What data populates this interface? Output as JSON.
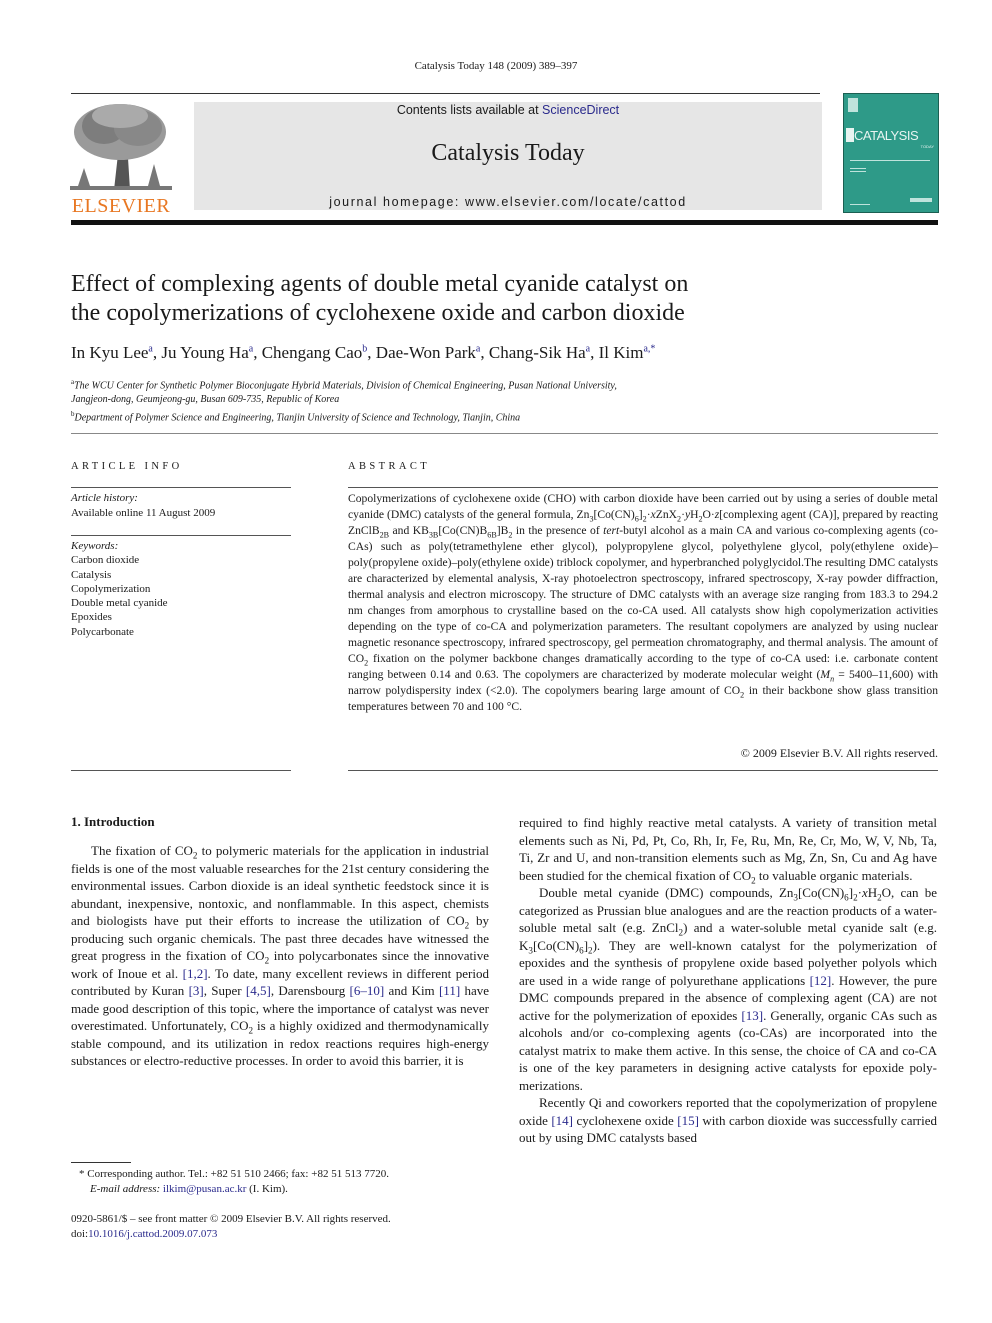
{
  "running_head": "Catalysis Today 148 (2009) 389–397",
  "masthead": {
    "publisher": "ELSEVIER",
    "publisher_color": "#e87722",
    "contents_prefix": "Contents lists available at ",
    "contents_link": "ScienceDirect",
    "journal_name": "Catalysis Today",
    "homepage": "journal homepage: www.elsevier.com/locate/cattod",
    "cover_title": "CATALYSIS",
    "cover_subtitle": "TODAY",
    "cover_color": "#2e9a88",
    "banner_color": "#e6e6e6"
  },
  "article": {
    "title_line1": "Effect of complexing agents of double metal cyanide catalyst on",
    "title_line2": "the copolymerizations of cyclohexene oxide and carbon dioxide",
    "authors": [
      {
        "name": "In Kyu Lee",
        "aff": "a"
      },
      {
        "name": "Ju Young Ha",
        "aff": "a"
      },
      {
        "name": "Chengang Cao",
        "aff": "b"
      },
      {
        "name": "Dae-Won Park",
        "aff": "a"
      },
      {
        "name": "Chang-Sik Ha",
        "aff": "a"
      },
      {
        "name": "Il Kim",
        "aff": "a,*"
      }
    ],
    "affiliations": [
      {
        "mark": "a",
        "text": "The WCU Center for Synthetic Polymer Bioconjugate Hybrid Materials, Division of Chemical Engineering, Pusan National University,",
        "text2": "Jangjeon-dong, Geumjeong-gu, Busan 609-735, Republic of Korea"
      },
      {
        "mark": "b",
        "text": "Department of Polymer Science and Engineering, Tianjin University of Science and Technology, Tianjin, China"
      }
    ]
  },
  "article_info": {
    "heading": "ARTICLE INFO",
    "history_label": "Article history:",
    "history_value": "Available online 11 August 2009",
    "keywords_label": "Keywords:",
    "keywords": [
      "Carbon dioxide",
      "Catalysis",
      "Copolymerization",
      "Double metal cyanide",
      "Epoxides",
      "Polycarbonate"
    ]
  },
  "abstract": {
    "heading": "ABSTRACT",
    "s1": "Copolymerizations of cyclohexene oxide (CHO) with carbon dioxide have been carried out by using a series of double metal cyanide (DMC) catalysts of the general formula, Zn",
    "s2": "agent (CA)], prepared by reacting ZnClB",
    "s3": " in the presence of ",
    "s3_it": "tert",
    "s4": "-butyl alcohol as a main CA and various co-complexing agents (co-CAs) such as poly(tetramethylene ether glycol), polypropylene glycol, polyethylene glycol, poly(ethylene oxide)–poly(propylene oxide)–poly(ethylene oxide) triblock copolymer, and hyperbranched polyglycidol.The resulting DMC catalysts are characterized by elemental analysis, X-ray photoelectron spectroscopy, infrared spectroscopy, X-ray powder diffraction, thermal analysis and electron microscopy. The structure of DMC catalysts with an average size ranging from 183.3 to 294.2 nm changes from amorphous to crystalline based on the co-CA used. All catalysts show high copolymerization activities depending on the type of co-CA and polymerization parameters. The resultant copolymers are analyzed by using nuclear magnetic resonance spectroscopy, infrared spectroscopy, gel permeation chromatography, and thermal analysis. The amount of CO",
    "s5": " fixation on the polymer backbone changes dramatically according to the type of co-CA used: i.e. carbonate content ranging between 0.14 and 0.63. The copolymers are characterized by moderate molecular weight (",
    "s6": " = 5400–11,600) with narrow polydispersity index (<2.0). The copolymers bearing large amount of CO",
    "s7": " in their backbone show glass transition temperatures between 70 and 100 °C.",
    "copyright": "© 2009 Elsevier B.V. All rights reserved."
  },
  "intro": {
    "heading": "1.  Introduction",
    "p1a": "The fixation of CO",
    "p1b": " to polymeric materials for the application in industrial fields is one of the most valuable researches for the 21st century considering the environmental issues. Carbon dioxide is an ideal synthetic feedstock since it is abundant, inexpensive, nontoxic, and nonflammable. In this aspect, chemists and biologists have put their efforts to increase the utilization of CO",
    "p1c": " by producing such organic chemicals. The past three decades have witnessed the great progress in the fixation of CO",
    "p1d": " into polycarbonates since the innovative work of Inoue et al. ",
    "ref_1_2": "[1,2]",
    "p1e": ". To date, many excellent reviews in different period contributed by Kuran ",
    "ref_3": "[3]",
    "p1f": ", Super ",
    "ref_4_5": "[4,5]",
    "p1g": ", Darensbourg ",
    "ref_6_10": "[6–10]",
    "p1h": " and Kim ",
    "ref_11": "[11]",
    "p1i": " have made good description of this topic, where the importance of catalyst was never overestimated. Unfortunately, CO",
    "p1j": " is a highly oxidized and thermodynamically stable compound, and its utilization in redox reactions requires high-energy substances or electro-reductive processes. In order to avoid this barrier, it is",
    "r1a": "required to find highly reactive metal catalysts. A variety of transition metal elements such as Ni, Pd, Pt, Co, Rh, Ir, Fe, Ru, Mn, Re, Cr, Mo, W, V, Nb, Ta, Ti, Zr and U, and non-transition elements such as Mg, Zn, Sn, Cu and Ag have been studied for the chemical fixation of CO",
    "r1b": " to valuable organic materials.",
    "p2a": "Double metal cyanide (DMC) compounds, Zn",
    "p2b": "O, can be categorized as Prussian blue analogues and are the reaction products of a water-soluble metal salt (e.g. ZnCl",
    "p2c": ") and a water-soluble metal cyanide salt (e.g. K",
    "p2d": "). They are well-known catalyst for the polymerization of epoxides and the synthesis of propylene oxide based polyether polyols which are used in a wide range of polyurethane applications ",
    "ref_12": "[12]",
    "p2e": ". However, the pure DMC compounds prepared in the absence of complexing agent (CA) are not active for the polymerization of epoxides ",
    "ref_13": "[13]",
    "p2f": ". Generally, organic CAs such as alcohols and/or co-complexing agents (co-CAs) are incorporated into the catalyst matrix to make them active. In this sense, the choice of CA and co-CA is one of the key parameters in designing active catalysts for epoxide poly-merizations.",
    "p3a": "Recently Qi and coworkers reported that the copolymerization of propylene oxide ",
    "ref_14": "[14]",
    "p3b": " cyclohexene oxide ",
    "ref_15": "[15]",
    "p3c": " with carbon dioxide was successfully carried out by using DMC catalysts based"
  },
  "footnotes": {
    "corresponding": "* Corresponding author. Tel.: +82 51 510 2466; fax: +82 51 513 7720.",
    "email_label": "E-mail address:",
    "email": "ilkim@pusan.ac.kr",
    "email_suffix": " (I. Kim).",
    "front_matter": "0920-5861/$ – see front matter © 2009 Elsevier B.V. All rights reserved.",
    "doi_prefix": "doi:",
    "doi": "10.1016/j.cattod.2009.07.073"
  }
}
